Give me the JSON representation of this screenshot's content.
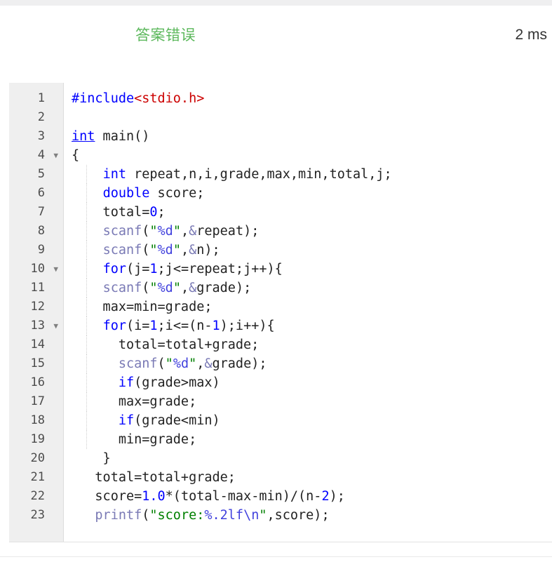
{
  "header": {
    "verdict": "答案错误",
    "runtime": "2 ms"
  },
  "editor": {
    "language": "c",
    "colors": {
      "keyword": "#0000ff",
      "string": "#008000",
      "include": "#cc0000",
      "number": "#0000ff",
      "function": "#7a7ab5",
      "format_specifier": "#4242dd",
      "gutter_bg": "#efefef",
      "verdict_green": "#5cb85c"
    },
    "fold_markers": [
      4,
      10,
      13
    ],
    "line_numbers": [
      "1",
      "2",
      "3",
      "4",
      "5",
      "6",
      "7",
      "8",
      "9",
      "10",
      "11",
      "12",
      "13",
      "14",
      "15",
      "16",
      "17",
      "18",
      "19",
      "20",
      "21",
      "22",
      "23"
    ],
    "lines": [
      "#include<stdio.h>",
      "",
      "int main()",
      "{",
      "    int repeat,n,i,grade,max,min,total,j;",
      "    double score;",
      "    total=0;",
      "    scanf(\"%d\",&repeat);",
      "    scanf(\"%d\",&n);",
      "    for(j=1;j<=repeat;j++){",
      "    scanf(\"%d\",&grade);",
      "    max=min=grade;",
      "    for(i=1;i<=(n-1);i++){",
      "      total=total+grade;",
      "      scanf(\"%d\",&grade);",
      "      if(grade>max)",
      "      max=grade;",
      "      if(grade<min)",
      "      min=grade;",
      "    }",
      "   total=total+grade;",
      "   score=1.0*(total-max-min)/(n-2);",
      "   printf(\"score:%.2lf\\n\",score);"
    ]
  }
}
